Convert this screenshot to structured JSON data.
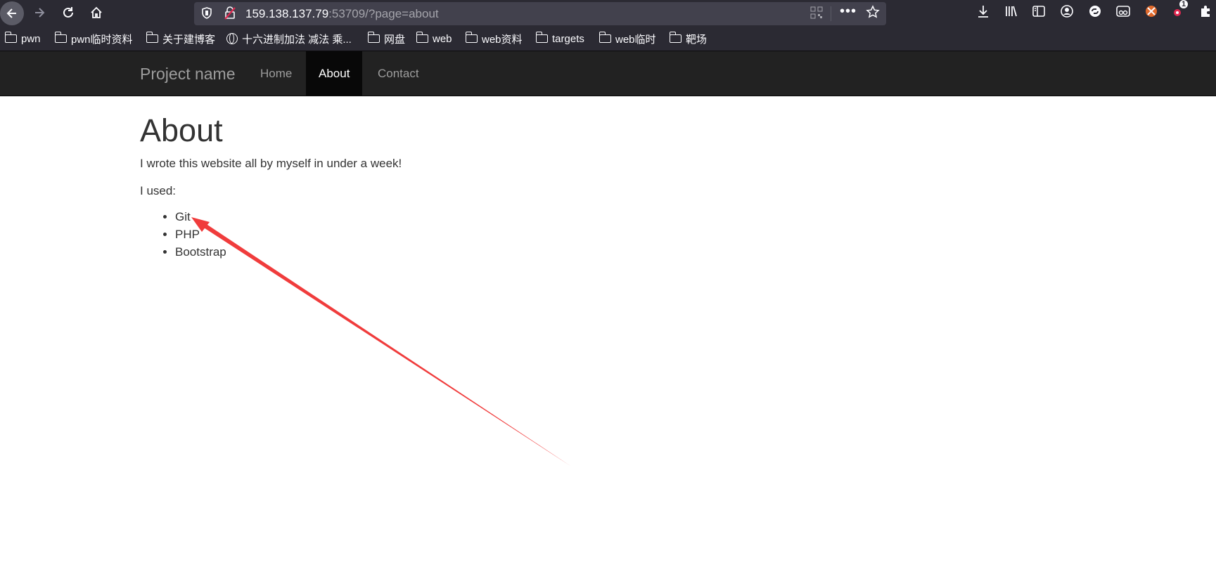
{
  "browser": {
    "url_host": "159.138.137.79",
    "url_rest": ":53709/?page=about",
    "icons": {
      "back": "back-arrow-icon",
      "forward": "forward-arrow-icon",
      "reload": "reload-icon",
      "home": "home-icon",
      "shield": "tracking-shield-icon",
      "insecure": "insecure-lock-icon",
      "qr": "qr-code-icon",
      "more": "more-dots-icon",
      "star": "bookmark-star-icon"
    },
    "extension_badge": "1"
  },
  "bookmarks": [
    {
      "label": "pwn",
      "icon": "folder-icon"
    },
    {
      "label": "pwn临时资料",
      "icon": "folder-icon"
    },
    {
      "label": "关于建博客",
      "icon": "folder-icon"
    },
    {
      "label": "十六进制加法 减法 乘...",
      "icon": "globe-icon"
    },
    {
      "label": "网盘",
      "icon": "folder-icon"
    },
    {
      "label": "web",
      "icon": "folder-icon"
    },
    {
      "label": "web资料",
      "icon": "folder-icon"
    },
    {
      "label": "targets",
      "icon": "folder-icon"
    },
    {
      "label": "web临时",
      "icon": "folder-icon"
    },
    {
      "label": "靶场",
      "icon": "folder-icon"
    }
  ],
  "navbar": {
    "brand": "Project name",
    "items": [
      {
        "label": "Home",
        "active": false
      },
      {
        "label": "About",
        "active": true
      },
      {
        "label": "Contact",
        "active": false
      }
    ]
  },
  "page": {
    "heading": "About",
    "paragraph1": "I wrote this website all by myself in under a week!",
    "paragraph2": "I used:",
    "list": [
      "Git",
      "PHP",
      "Bootstrap"
    ]
  },
  "annotation": {
    "arrow_color": "#f03c3c"
  }
}
